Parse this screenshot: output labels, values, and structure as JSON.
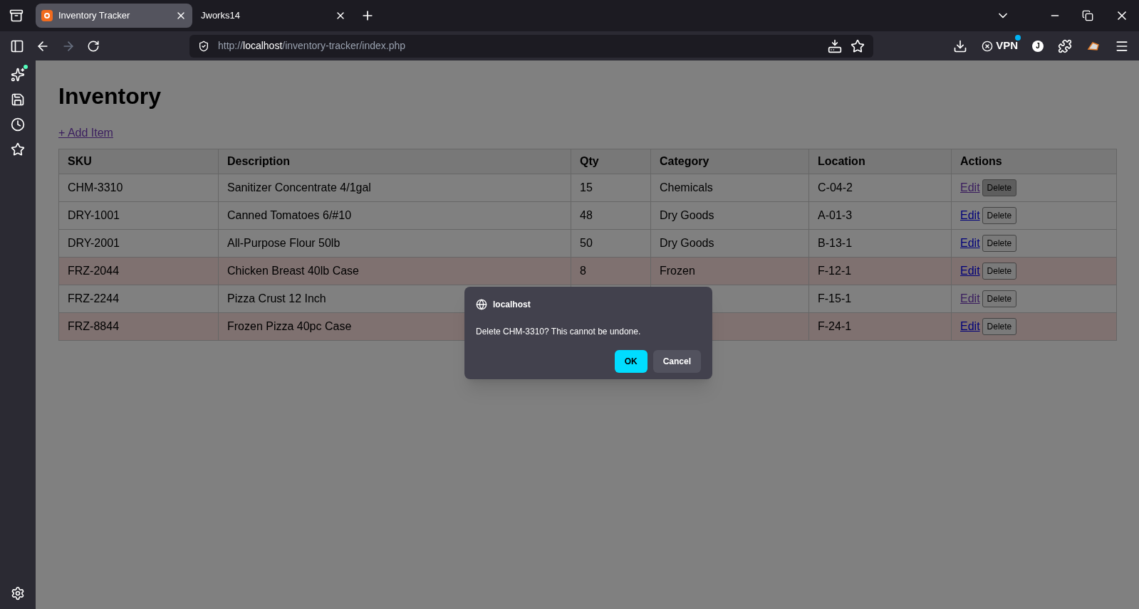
{
  "browser": {
    "tabs": [
      {
        "title": "Inventory Tracker",
        "selected": true,
        "favicon": true
      },
      {
        "title": "Jworks14",
        "selected": false,
        "favicon": false
      }
    ],
    "url": {
      "scheme": "http://",
      "host": "localhost",
      "path": "/inventory-tracker/index.php"
    },
    "vpn_label": "VPN",
    "profile_initial": "J"
  },
  "page": {
    "title": "Inventory",
    "add_link": "+ Add Item",
    "table": {
      "columns": [
        "SKU",
        "Description",
        "Qty",
        "Category",
        "Location",
        "Actions"
      ],
      "rows": [
        {
          "sku": "CHM-3310",
          "description": "Sanitizer Concentrate 4/1gal",
          "qty": "15",
          "category": "Chemicals",
          "location": "C-04-2",
          "highlighted": false,
          "edit": "Edit",
          "edit_visited": true,
          "delete": "Delete",
          "delete_active": true
        },
        {
          "sku": "DRY-1001",
          "description": "Canned Tomatoes 6/#10",
          "qty": "48",
          "category": "Dry Goods",
          "location": "A-01-3",
          "highlighted": false,
          "edit": "Edit",
          "edit_visited": false,
          "delete": "Delete",
          "delete_active": false
        },
        {
          "sku": "DRY-2001",
          "description": "All-Purpose Flour 50lb",
          "qty": "50",
          "category": "Dry Goods",
          "location": "B-13-1",
          "highlighted": false,
          "edit": "Edit",
          "edit_visited": false,
          "delete": "Delete",
          "delete_active": false
        },
        {
          "sku": "FRZ-2044",
          "description": "Chicken Breast 40lb Case",
          "qty": "8",
          "category": "Frozen",
          "location": "F-12-1",
          "highlighted": true,
          "edit": "Edit",
          "edit_visited": false,
          "delete": "Delete",
          "delete_active": false
        },
        {
          "sku": "FRZ-2244",
          "description": "Pizza Crust 12 Inch",
          "location": "F-15-1",
          "highlighted": false,
          "edit": "Edit",
          "edit_visited": true,
          "delete": "Delete",
          "delete_active": false
        },
        {
          "sku": "FRZ-8844",
          "description": "Frozen Pizza 40pc Case",
          "location": "F-24-1",
          "highlighted": true,
          "edit": "Edit",
          "edit_visited": false,
          "delete": "Delete",
          "delete_active": false
        }
      ]
    }
  },
  "dialog": {
    "origin": "localhost",
    "message": "Delete CHM-3310? This cannot be undone.",
    "buttons": [
      {
        "label": "OK",
        "kind": "primary"
      },
      {
        "label": "Cancel",
        "kind": "secondary"
      }
    ]
  }
}
